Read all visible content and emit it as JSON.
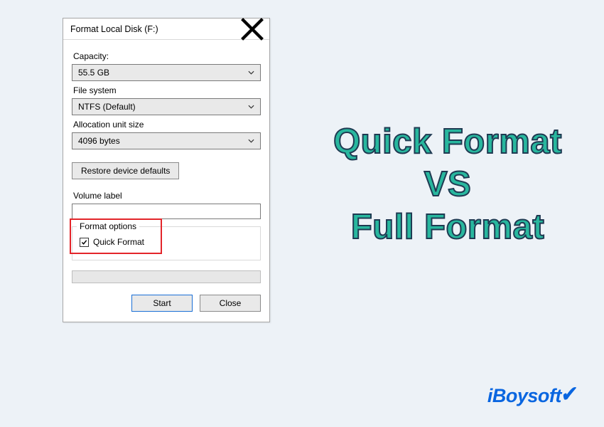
{
  "dialog": {
    "title": "Format Local Disk (F:)",
    "capacity_label": "Capacity:",
    "capacity_value": "55.5 GB",
    "filesystem_label": "File system",
    "filesystem_value": "NTFS (Default)",
    "allocation_label": "Allocation unit size",
    "allocation_value": "4096 bytes",
    "restore_label": "Restore device defaults",
    "volume_label": "Volume label",
    "volume_value": "",
    "format_options_label": "Format options",
    "quick_format_label": "Quick Format",
    "start_label": "Start",
    "close_label": "Close"
  },
  "hero": {
    "line1": "Quick Format",
    "line2": "VS",
    "line3": "Full Format"
  },
  "brand": "iBoysoft"
}
